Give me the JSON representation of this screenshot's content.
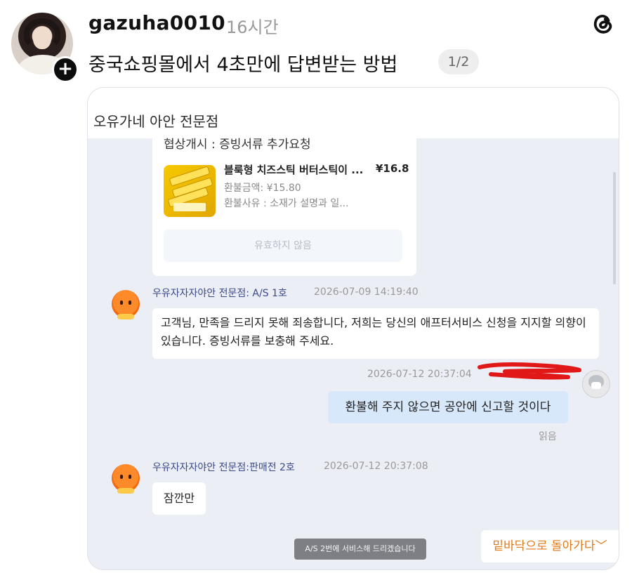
{
  "post": {
    "username": "gazuha0010",
    "time": "16시간",
    "text": "중국쇼핑몰에서 4초만에 답변받는 방법",
    "page_indicator": "1/2",
    "follow_symbol": "+",
    "icons": {
      "avatar": "profile-photo",
      "follow": "plus-icon",
      "logo": "threads-logo-icon"
    }
  },
  "chat": {
    "shop_name": "오유가네 아안 전문점",
    "card": {
      "status": "협상개시 : 증빙서류 추가요청",
      "product_name": "블룩형 치즈스틱 버터스틱이 ...",
      "product_price": "¥16.8",
      "refund_amount": "환불금액: ¥15.80",
      "refund_reason": "환불사유 : 소재가 설명과 일...",
      "invalid_button": "유효하지 않음"
    },
    "messages": [
      {
        "sender": "우유자자자야안 전문점: A/S 1호",
        "time": "2026-07-09 14:19:40",
        "text": "고객님, 만족을 드리지 못해 죄송합니다, 저희는 당신의 애프터서비스 신청을 지지할 의향이 있습니다. 증빙서류를 보충해 주세요."
      },
      {
        "time": "2026-07-12 20:37:04",
        "text": "환불해 주지 않으면 공안에 신고할 것이다",
        "status": "읽음"
      },
      {
        "sender": "우유자자자야안 전문점:판매전 2호",
        "time": "2026-07-12 20:37:08",
        "text": "잠깐만"
      }
    ],
    "toast": "A/S 2번에 서비스해 드리겠습니다",
    "scroll_to_bottom": "밑바닥으로 돌아가다",
    "colors": {
      "accent_orange": "#e07a1a",
      "user_bubble": "#d7e8fb",
      "sender_name": "#3b4a8a",
      "redaction": "#e01818"
    }
  }
}
